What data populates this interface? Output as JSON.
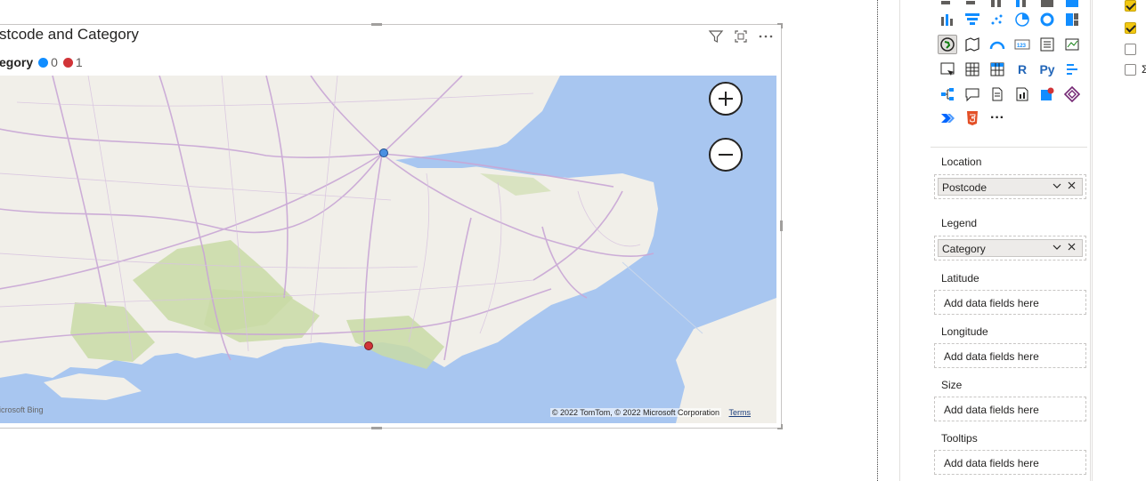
{
  "visual": {
    "title": "stcode and Category",
    "legend_title": "egory",
    "legend_items": [
      {
        "label": "0",
        "color": "#118dff"
      },
      {
        "label": "1",
        "color": "#d13438"
      }
    ],
    "copyright": "© 2022 TomTom, © 2022 Microsoft Corporation",
    "terms": "Terms",
    "bing": "icrosoft Bing",
    "zoom_in": "+",
    "zoom_out": "−"
  },
  "colors": {
    "sea": "#a8c6f0",
    "land": "#f1efe9",
    "park": "#c9dba6",
    "road": "#c9a6d6",
    "point_0": "#4a90e2",
    "point_1": "#d13438"
  },
  "viz_pane": {
    "icons": [
      "stacked-bar-icon",
      "clustered-bar-icon",
      "stacked-column-icon",
      "clustered-column-icon",
      "100-bar-icon",
      "100-column-icon",
      "ribbon-chart-icon",
      "funnel-icon",
      "scatter-icon",
      "pie-icon",
      "donut-icon",
      "treemap-icon",
      "map-icon",
      "filled-map-icon",
      "gauge-icon",
      "card-icon",
      "multirow-card-icon",
      "kpi-icon",
      "slicer-icon",
      "table-icon",
      "matrix-icon",
      "r-visual-icon",
      "python-visual-icon",
      "key-influencers-icon",
      "decomposition-tree-icon",
      "qa-icon",
      "smart-narrative-icon",
      "paginated-report-icon",
      "azure-map-icon",
      "power-apps-icon",
      "power-automate-icon",
      "html-icon",
      "more-visuals-icon"
    ],
    "r_label": "R",
    "py_label": "Py",
    "more_label": "···",
    "wells": [
      {
        "label": "Location",
        "value": "Postcode"
      },
      {
        "label": "Legend",
        "value": "Category"
      },
      {
        "label": "Latitude",
        "placeholder": "Add data fields here"
      },
      {
        "label": "Longitude",
        "placeholder": "Add data fields here"
      },
      {
        "label": "Size",
        "placeholder": "Add data fields here"
      },
      {
        "label": "Tooltips",
        "placeholder": "Add data fields here"
      }
    ]
  },
  "fields_pane": {
    "checks": [
      true,
      true,
      false,
      false
    ]
  }
}
